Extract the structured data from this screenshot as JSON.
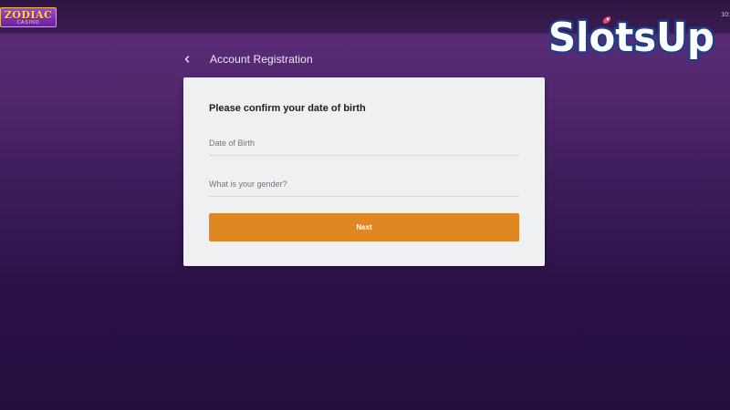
{
  "topbar": {
    "logo_text": "ZODIAC",
    "logo_subtext": "CASINO",
    "clock": "10:"
  },
  "header": {
    "back_icon": "chevron-left-icon",
    "title": "Account Registration"
  },
  "form": {
    "heading": "Please confirm your date of birth",
    "dob_placeholder": "Date of Birth",
    "gender_placeholder": "What is your gender?",
    "next_label": "Next"
  },
  "watermark": {
    "text": "SlotsUp"
  },
  "colors": {
    "background_top": "#5e2e7e",
    "background_bottom": "#241040",
    "card": "#eef0f2",
    "button": "#de8723",
    "watermark_fill": "#ffffff",
    "watermark_outline": "#1f3e86",
    "watermark_rocket": "#e8467c"
  }
}
